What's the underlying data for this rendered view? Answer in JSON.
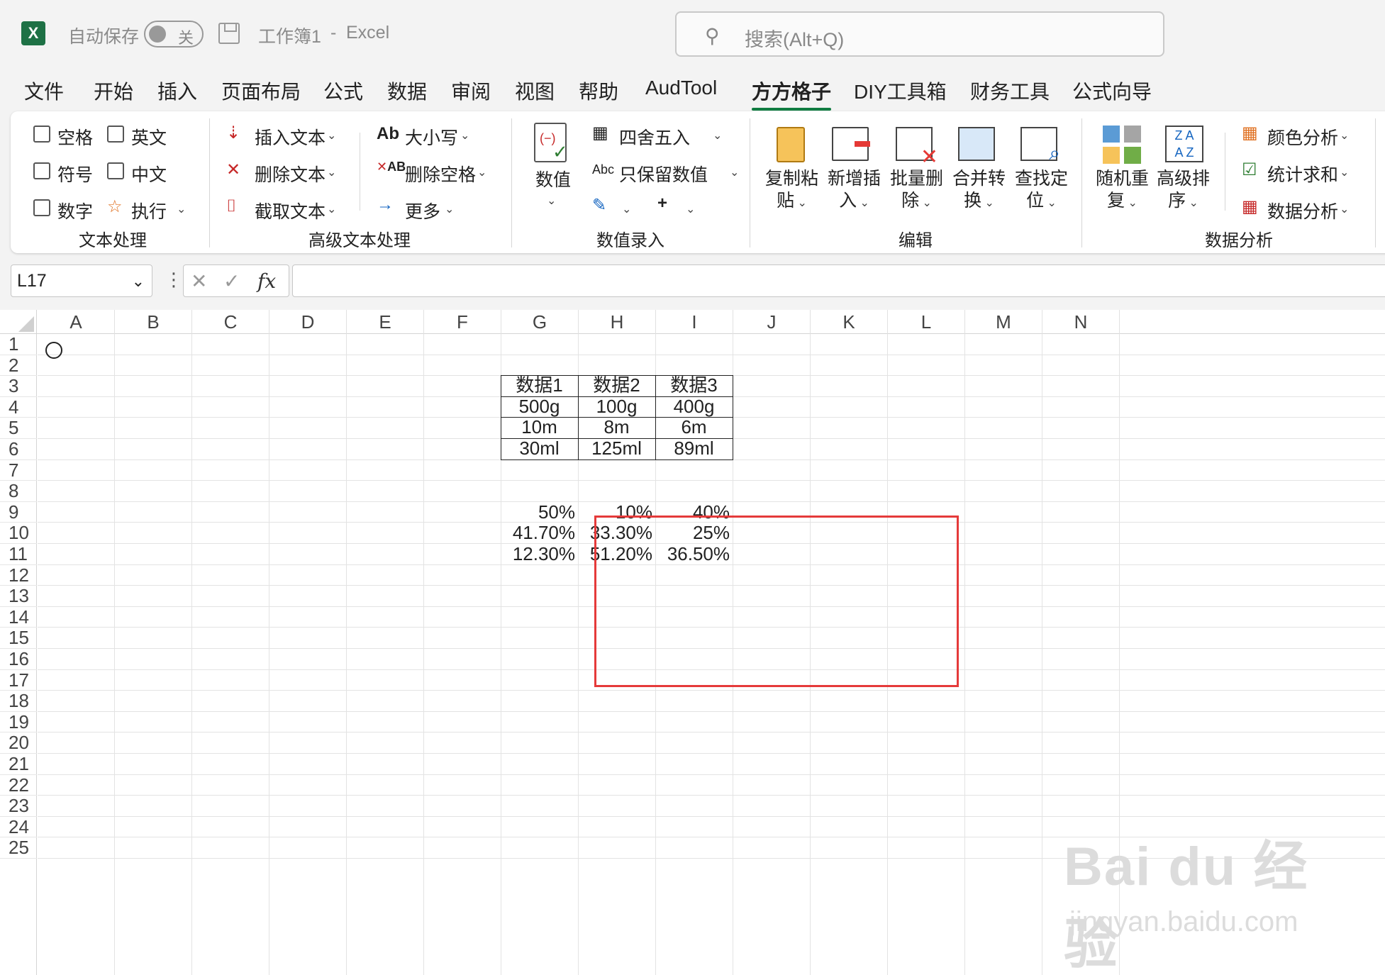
{
  "titlebar": {
    "app_icon": "excel-icon",
    "autosave_label": "自动保存",
    "autosave_state": "关",
    "doc_title": "工作簿1",
    "sep": "-",
    "app_name": "Excel",
    "search_placeholder": "搜索(Alt+Q)"
  },
  "menu": {
    "tabs": [
      "文件",
      "开始",
      "插入",
      "页面布局",
      "公式",
      "数据",
      "审阅",
      "视图",
      "帮助",
      "AudTool",
      "方方格子",
      "DIY工具箱",
      "财务工具",
      "公式向导"
    ],
    "active": "方方格子"
  },
  "ribbon": {
    "text_group": {
      "label": "文本处理",
      "checks": [
        "空格",
        "英文",
        "符号",
        "中文",
        "数字"
      ],
      "execute": "执行"
    },
    "adv_text_group": {
      "label": "高级文本处理",
      "insert_text": "插入文本",
      "delete_text": "删除文本",
      "extract_text": "截取文本",
      "case": "大小写",
      "delete_space": "删除空格",
      "more": "更多"
    },
    "num_group": {
      "label": "数值录入",
      "value_btn": "数值",
      "round": "四舍五入",
      "keep_number": "只保留数值"
    },
    "edit_group": {
      "label": "编辑",
      "buttons": [
        {
          "l1": "复制粘",
          "l2": "贴"
        },
        {
          "l1": "新增插",
          "l2": "入"
        },
        {
          "l1": "批量删",
          "l2": "除"
        },
        {
          "l1": "合并转",
          "l2": "换"
        },
        {
          "l1": "查找定",
          "l2": "位"
        }
      ]
    },
    "analysis_group": {
      "label": "数据分析",
      "random": {
        "l1": "随机重",
        "l2": "复"
      },
      "sort": {
        "l1": "高级排",
        "l2": "序"
      },
      "color_analysis": "颜色分析",
      "stat_sum": "统计求和",
      "data_analysis": "数据分析"
    }
  },
  "formula_bar": {
    "name_box": "L17",
    "fx": "fx",
    "value": ""
  },
  "sheet": {
    "columns": [
      "A",
      "B",
      "C",
      "D",
      "E",
      "F",
      "G",
      "H",
      "I",
      "J",
      "K",
      "L",
      "M",
      "N"
    ],
    "rows": [
      "1",
      "2",
      "3",
      "4",
      "5",
      "6",
      "7",
      "8",
      "9",
      "10",
      "11",
      "12",
      "13",
      "14",
      "15",
      "16",
      "17",
      "18",
      "19",
      "20",
      "21",
      "22",
      "23",
      "24",
      "25"
    ],
    "table_header": [
      "数据1",
      "数据2",
      "数据3"
    ],
    "table_rows": [
      [
        "500g",
        "100g",
        "400g"
      ],
      [
        "10m",
        "8m",
        "6m"
      ],
      [
        "30ml",
        "125ml",
        "89ml"
      ]
    ],
    "pct_rows": [
      [
        "50%",
        "10%",
        "40%"
      ],
      [
        "41.70%",
        "33.30%",
        "25%"
      ],
      [
        "12.30%",
        "51.20%",
        "36.50%"
      ]
    ],
    "highlight_color": "#e53a3a"
  },
  "watermark": {
    "brand": "Bai du 经验",
    "url": "jingyan.baidu.com"
  }
}
